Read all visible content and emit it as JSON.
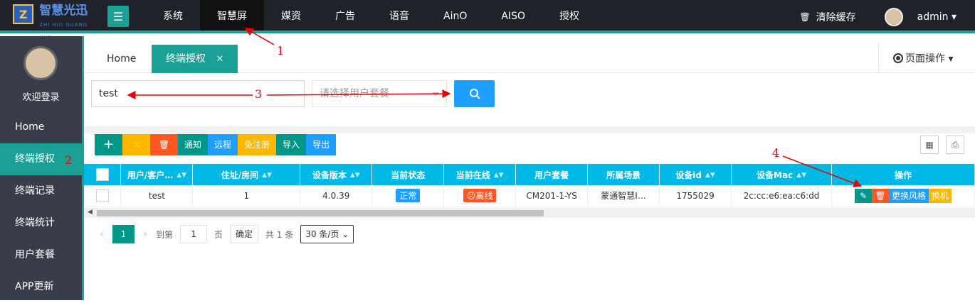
{
  "header": {
    "logo_text": "智慧光迅",
    "logo_sub": "ZHI HUI GUANG XUN",
    "menu_toggle": "☰",
    "nav": [
      "系统",
      "智慧屏",
      "媒资",
      "广告",
      "语音",
      "AinO",
      "AISO",
      "授权"
    ],
    "clear_cache": "清除缓存",
    "user": "admin ▾"
  },
  "sidebar": {
    "welcome": "欢迎登录",
    "items": [
      "Home",
      "终端授权",
      "终端记录",
      "终端统计",
      "用户套餐",
      "APP更新"
    ]
  },
  "tabs": {
    "home": "Home",
    "active": "终端授权",
    "close": "✕",
    "page_ops": "页面操作 ▾"
  },
  "search": {
    "input_value": "test",
    "select_placeholder": "请选择用户套餐"
  },
  "toolbar": {
    "add": "+",
    "loading": "⁙",
    "delete": "🗑",
    "notify": "通知",
    "remote": "远程",
    "free_register": "免注册",
    "import": "导入",
    "export": "导出"
  },
  "table": {
    "headers": [
      "用户/客户…",
      "住址/房间",
      "设备版本",
      "当前状态",
      "当前在线",
      "用户套餐",
      "所属场景",
      "设备id",
      "设备Mac",
      "操作"
    ],
    "row": {
      "user": "test",
      "room": "1",
      "version": "4.0.39",
      "status": "正常",
      "online": "☹离线",
      "package": "CM201-1-YS",
      "scene": "蒙通智慧I…",
      "device_id": "1755029",
      "mac": "2c:cc:e6:ea:c6:dd",
      "op_edit": "✎",
      "op_delete": "🗑",
      "op_style": "更换风格",
      "op_switch": "换机"
    }
  },
  "pagination": {
    "prev": "‹",
    "current": "1",
    "next": "›",
    "goto_label": "到第",
    "goto_value": "1",
    "page_unit": "页",
    "confirm": "确定",
    "total": "共 1 条",
    "per_page": "30 条/页 ⌄"
  },
  "annotations": [
    "1",
    "2",
    "3",
    "4"
  ],
  "colors": {
    "accent": "#1aa094",
    "header_bg": "#20222a",
    "sidebar_bg": "#393d49",
    "table_header": "#00b9e6",
    "blue": "#1e9fff",
    "orange": "#ff5722",
    "yellow": "#ffb800"
  }
}
